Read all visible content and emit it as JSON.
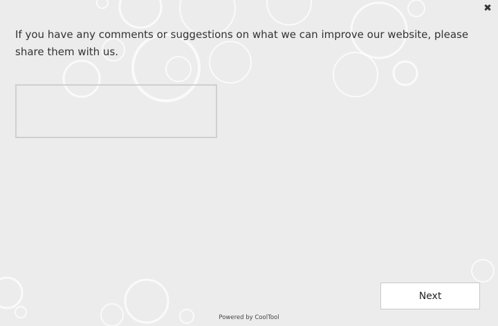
{
  "dialog": {
    "close_glyph": "✖",
    "question": "If you have any comments or suggestions on what we can improve our website, please share them with us.",
    "comment_value": "",
    "next_label": "Next",
    "footer": "Powered by CoolTool"
  },
  "colors": {
    "background": "#ececec",
    "bubble_stroke": "#ffffff",
    "text": "#333333",
    "input_border": "#cfcfcf",
    "button_bg": "#ffffff"
  }
}
